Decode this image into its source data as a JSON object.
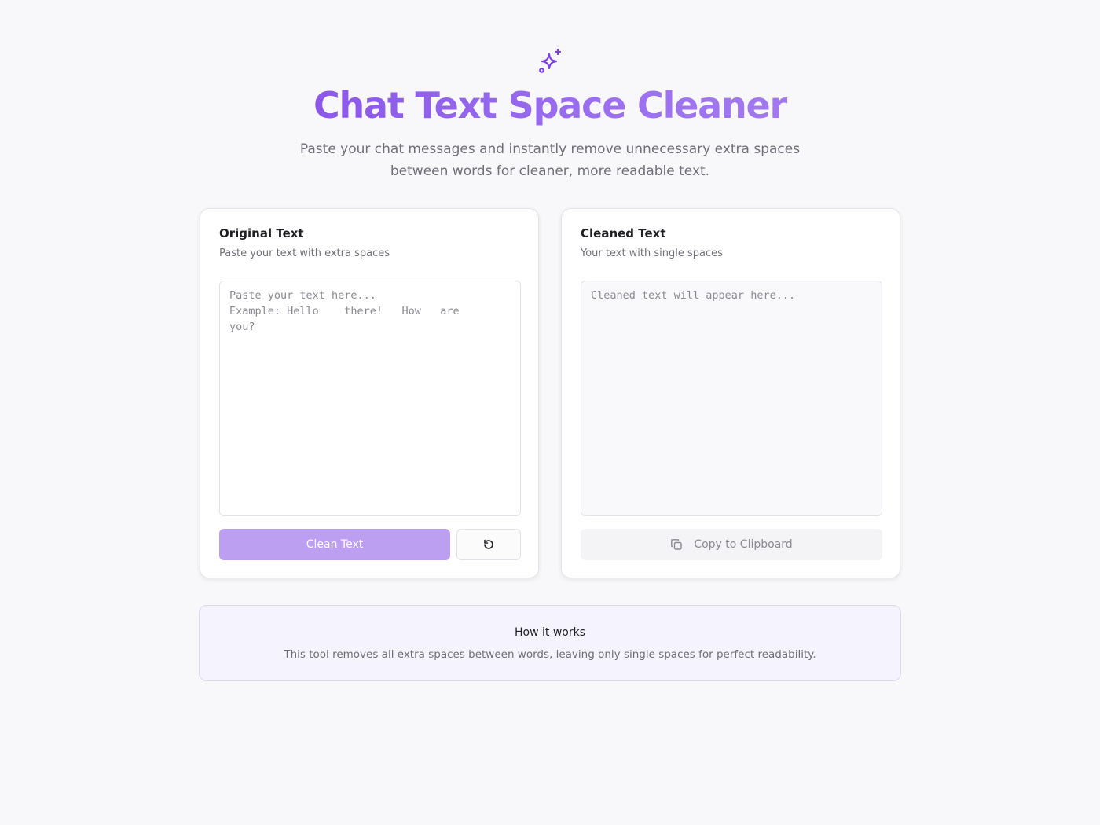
{
  "header": {
    "icon": "sparkles-icon",
    "title": "Chat Text Space Cleaner",
    "subtitle": "Paste your chat messages and instantly remove unnecessary extra spaces between words for cleaner, more readable text."
  },
  "original": {
    "title": "Original Text",
    "description": "Paste your text with extra spaces",
    "placeholder": "Paste your text here...\nExample: Hello    there!   How   are\nyou?",
    "value": "",
    "clean_label": "Clean Text",
    "reset_icon": "rotate-ccw-icon"
  },
  "cleaned": {
    "title": "Cleaned Text",
    "description": "Your text with single spaces",
    "placeholder": "Cleaned text will appear here...",
    "value": "",
    "copy_label": "Copy to Clipboard",
    "copy_icon": "copy-icon"
  },
  "info": {
    "title": "How it works",
    "text": "This tool removes all extra spaces between words, leaving only single spaces for perfect readability."
  },
  "colors": {
    "accent": "#7b3fe4",
    "accent_light": "#bd9ff2",
    "info_background": "#f5f3fe"
  }
}
